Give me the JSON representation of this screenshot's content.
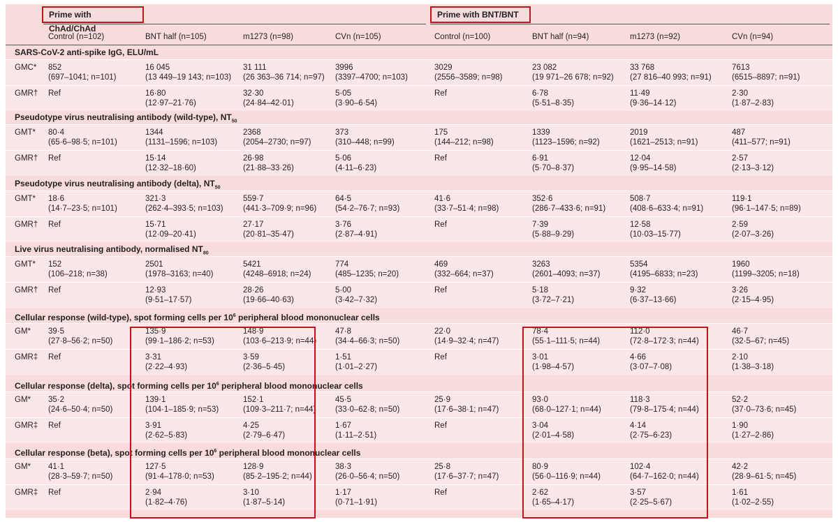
{
  "groups": [
    {
      "label": "Prime with ChAd/ChAd"
    },
    {
      "label": "Prime with BNT/BNT"
    }
  ],
  "columns": [
    "Control (n=102)",
    "BNT half (n=105)",
    "m1273 (n=98)",
    "CVn (n=105)",
    "Control (n=100)",
    "BNT half (n=94)",
    "m1273 (n=92)",
    "CVn (n=94)"
  ],
  "sections": [
    {
      "title": "SARS-CoV-2 anti-spike IgG, ELU/mL",
      "rows": [
        {
          "label": "GMC*",
          "cells": [
            [
              "852",
              "(697–1041; n=101)"
            ],
            [
              "16 045",
              "(13 449–19 143; n=103)"
            ],
            [
              "31 111",
              "(26 363–36 714; n=97)"
            ],
            [
              "3996",
              "(3397–4700; n=103)"
            ],
            [
              "3029",
              "(2556–3589; n=98)"
            ],
            [
              "23 082",
              "(19 971–26 678; n=92)"
            ],
            [
              "33 768",
              "(27 816–40 993; n=91)"
            ],
            [
              "7613",
              "(6515–8897; n=91)"
            ]
          ]
        },
        {
          "label": "GMR†",
          "cells": [
            [
              "Ref",
              ""
            ],
            [
              "16·80",
              "(12·97–21·76)"
            ],
            [
              "32·30",
              "(24·84–42·01)"
            ],
            [
              "5·05",
              "(3·90–6·54)"
            ],
            [
              "Ref",
              ""
            ],
            [
              "6·78",
              "(5·51–8·35)"
            ],
            [
              "11·49",
              "(9·36–14·12)"
            ],
            [
              "2·30",
              "(1·87–2·83)"
            ]
          ]
        }
      ]
    },
    {
      "title": "Pseudotype virus neutralising antibody (wild-type), NT",
      "title_sub": "50",
      "rows": [
        {
          "label": "GMT*",
          "cells": [
            [
              "80·4",
              "(65·6–98·5; n=101)"
            ],
            [
              "1344",
              "(1131–1596; n=103)"
            ],
            [
              "2368",
              "(2054–2730; n=97)"
            ],
            [
              "373",
              "(310–448; n=99)"
            ],
            [
              "175",
              "(144–212; n=98)"
            ],
            [
              "1339",
              "(1123–1596; n=92)"
            ],
            [
              "2019",
              "(1621–2513; n=91)"
            ],
            [
              "487",
              "(411–577; n=91)"
            ]
          ]
        },
        {
          "label": "GMR†",
          "cells": [
            [
              "Ref",
              ""
            ],
            [
              "15·14",
              "(12·32–18·60)"
            ],
            [
              "26·98",
              "(21·88–33·26)"
            ],
            [
              "5·06",
              "(4·11–6·23)"
            ],
            [
              "Ref",
              ""
            ],
            [
              "6·91",
              "(5·70–8·37)"
            ],
            [
              "12·04",
              "(9·95–14·58)"
            ],
            [
              "2·57",
              "(2·13–3·12)"
            ]
          ]
        }
      ]
    },
    {
      "title": "Pseudotype virus neutralising antibody (delta), NT",
      "title_sub": "50",
      "rows": [
        {
          "label": "GMT*",
          "cells": [
            [
              "18·6",
              "(14·7–23·5; n=101)"
            ],
            [
              "321·3",
              "(262·4–393·5; n=103)"
            ],
            [
              "559·7",
              "(441·3–709·9; n=96)"
            ],
            [
              "64·5",
              "(54·2–76·7; n=93)"
            ],
            [
              "41·6",
              "(33·7–51·4; n=98)"
            ],
            [
              "352·6",
              "(286·7–433·6; n=91)"
            ],
            [
              "508·7",
              "(408·6–633·4; n=91)"
            ],
            [
              "119·1",
              "(96·1–147·5; n=89)"
            ]
          ]
        },
        {
          "label": "GMR†",
          "cells": [
            [
              "Ref",
              ""
            ],
            [
              "15·71",
              "(12·09–20·41)"
            ],
            [
              "27·17",
              "(20·81–35·47)"
            ],
            [
              "3·76",
              "(2·87–4·91)"
            ],
            [
              "Ref",
              ""
            ],
            [
              "7·39",
              "(5·88–9·29)"
            ],
            [
              "12·58",
              "(10·03–15·77)"
            ],
            [
              "2·59",
              "(2·07–3·26)"
            ]
          ]
        }
      ]
    },
    {
      "title": "Live virus neutralising antibody, normalised NT",
      "title_sub": "80",
      "rows": [
        {
          "label": "GMT*",
          "cells": [
            [
              "152",
              "(106–218; n=38)"
            ],
            [
              "2501",
              "(1978–3163; n=40)"
            ],
            [
              "5421",
              "(4248–6918; n=24)"
            ],
            [
              "774",
              "(485–1235; n=20)"
            ],
            [
              "469",
              "(332–664; n=37)"
            ],
            [
              "3263",
              "(2601–4093; n=37)"
            ],
            [
              "5354",
              "(4195–6833; n=23)"
            ],
            [
              "1960",
              "(1199–3205; n=18)"
            ]
          ]
        },
        {
          "label": "GMR†",
          "cells": [
            [
              "Ref",
              ""
            ],
            [
              "12·93",
              "(9·51–17·57)"
            ],
            [
              "28·26",
              "(19·66–40·63)"
            ],
            [
              "5·00",
              "(3·42–7·32)"
            ],
            [
              "Ref",
              ""
            ],
            [
              "5·18",
              "(3·72–7·21)"
            ],
            [
              "9·32",
              "(6·37–13·66)"
            ],
            [
              "3·26",
              "(2·15–4·95)"
            ]
          ]
        }
      ]
    },
    {
      "title": "Cellular response (wild-type), spot forming cells per 10",
      "title_sup": "6",
      "title_end": " peripheral blood mononuclear cells",
      "rows": [
        {
          "label": "GM*",
          "cells": [
            [
              "39·5",
              "(27·8–56·2; n=50)"
            ],
            [
              "135·9",
              "(99·1–186·2; n=53)"
            ],
            [
              "148·9",
              "(103·6–213·9; n=44)"
            ],
            [
              "47·8",
              "(34·4–66·3; n=50)"
            ],
            [
              "22·0",
              "(14·9–32·4; n=47)"
            ],
            [
              "78·4",
              "(55·1–111·5; n=44)"
            ],
            [
              "112·0",
              "(72·8–172·3; n=44)"
            ],
            [
              "46·7",
              "(32·5–67; n=45)"
            ]
          ]
        },
        {
          "label": "GMR‡",
          "cells": [
            [
              "Ref",
              ""
            ],
            [
              "3·31",
              "(2·22–4·93)"
            ],
            [
              "3·59",
              "(2·36–5·45)"
            ],
            [
              "1·51",
              "(1·01–2·27)"
            ],
            [
              "Ref",
              ""
            ],
            [
              "3·01",
              "(1·98–4·57)"
            ],
            [
              "4·66",
              "(3·07–7·08)"
            ],
            [
              "2·10",
              "(1·38–3·18)"
            ]
          ]
        }
      ]
    },
    {
      "title": "Cellular response (delta), spot forming cells per 10",
      "title_sup": "6",
      "title_end": " peripheral blood mononuclear cells",
      "rows": [
        {
          "label": "GM*",
          "cells": [
            [
              "35·2",
              "(24·6–50·4; n=50)"
            ],
            [
              "139·1",
              "(104·1–185·9; n=53)"
            ],
            [
              "152·1",
              "(109·3–211·7; n=44)"
            ],
            [
              "45·5",
              "(33·0–62·8; n=50)"
            ],
            [
              "25·9",
              "(17·6–38·1; n=47)"
            ],
            [
              "93·0",
              "(68·0–127·1; n=44)"
            ],
            [
              "118·3",
              "(79·8–175·4; n=44)"
            ],
            [
              "52·2",
              "(37·0–73·6; n=45)"
            ]
          ]
        },
        {
          "label": "GMR‡",
          "cells": [
            [
              "Ref",
              ""
            ],
            [
              "3·91",
              "(2·62–5·83)"
            ],
            [
              "4·25",
              "(2·79–6·47)"
            ],
            [
              "1·67",
              "(1·11–2·51)"
            ],
            [
              "Ref",
              ""
            ],
            [
              "3·04",
              "(2·01–4·58)"
            ],
            [
              "4·14",
              "(2·75–6·23)"
            ],
            [
              "1·90",
              "(1·27–2·86)"
            ]
          ]
        }
      ]
    },
    {
      "title": "Cellular response (beta), spot forming cells per 10",
      "title_sup": "6",
      "title_end": " peripheral blood mononuclear cells",
      "rows": [
        {
          "label": "GM*",
          "cells": [
            [
              "41·1",
              "(28·3–59·7; n=50)"
            ],
            [
              "127·5",
              "(91·4–178·0; n=53)"
            ],
            [
              "128·9",
              "(85·2–195·2; n=44)"
            ],
            [
              "38·3",
              "(26·0–56·4; n=50)"
            ],
            [
              "25·8",
              "(17·6–37·7; n=47)"
            ],
            [
              "80·9",
              "(56·0–116·9; n=44)"
            ],
            [
              "102·4",
              "(64·7–162·0; n=44)"
            ],
            [
              "42·2",
              "(28·9–61·5; n=45)"
            ]
          ]
        },
        {
          "label": "GMR‡",
          "cells": [
            [
              "Ref",
              ""
            ],
            [
              "2·94",
              "(1·82–4·76)"
            ],
            [
              "3·10",
              "(1·87–5·14)"
            ],
            [
              "1·17",
              "(0·71–1·91)"
            ],
            [
              "Ref",
              ""
            ],
            [
              "2·62",
              "(1·65–4·17)"
            ],
            [
              "3·57",
              "(2·25–5·67)"
            ],
            [
              "1·61",
              "(1·02–2·55)"
            ]
          ]
        }
      ]
    }
  ]
}
